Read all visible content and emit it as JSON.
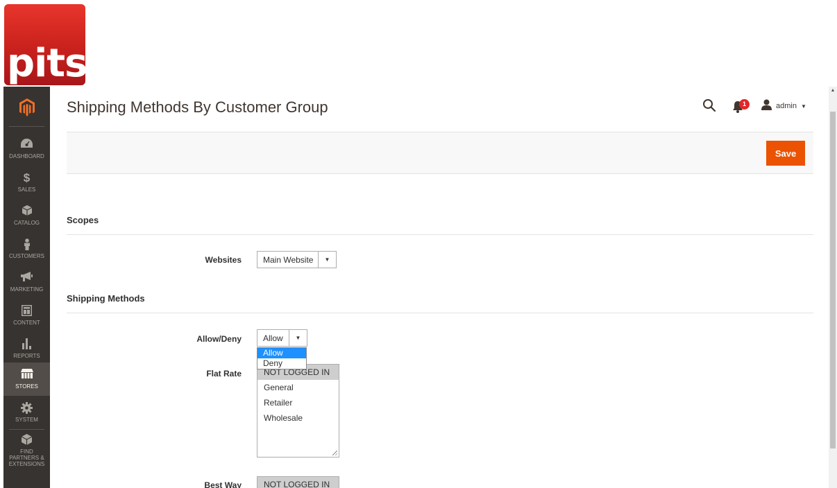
{
  "logo": {
    "text": "pits"
  },
  "sidebar": {
    "items": [
      {
        "label": "DASHBOARD"
      },
      {
        "label": "SALES",
        "icon": "$"
      },
      {
        "label": "CATALOG"
      },
      {
        "label": "CUSTOMERS"
      },
      {
        "label": "MARKETING"
      },
      {
        "label": "CONTENT"
      },
      {
        "label": "REPORTS"
      },
      {
        "label": "STORES"
      },
      {
        "label": "SYSTEM"
      },
      {
        "label": "FIND PARTNERS & EXTENSIONS"
      }
    ]
  },
  "header": {
    "title": "Shipping Methods By Customer Group",
    "notifications_count": "1",
    "user_name": "admin"
  },
  "actions": {
    "save_label": "Save"
  },
  "scopes": {
    "title": "Scopes",
    "websites_label": "Websites",
    "websites_value": "Main Website"
  },
  "shipping": {
    "title": "Shipping Methods",
    "allow_deny_label": "Allow/Deny",
    "allow_deny_value": "Allow",
    "allow_deny_options": [
      "Allow",
      "Deny"
    ],
    "flat_rate_label": "Flat Rate",
    "flat_rate_groups": [
      "NOT LOGGED IN",
      "General",
      "Retailer",
      "Wholesale"
    ],
    "best_way_label": "Best Way",
    "best_way_groups": [
      "NOT LOGGED IN"
    ]
  },
  "colors": {
    "sidebar_bg": "#373330",
    "sidebar_active": "#524d49",
    "accent": "#eb5202",
    "magento_orange": "#f46f25",
    "badge": "#e22626",
    "highlight": "#1e90ff"
  }
}
